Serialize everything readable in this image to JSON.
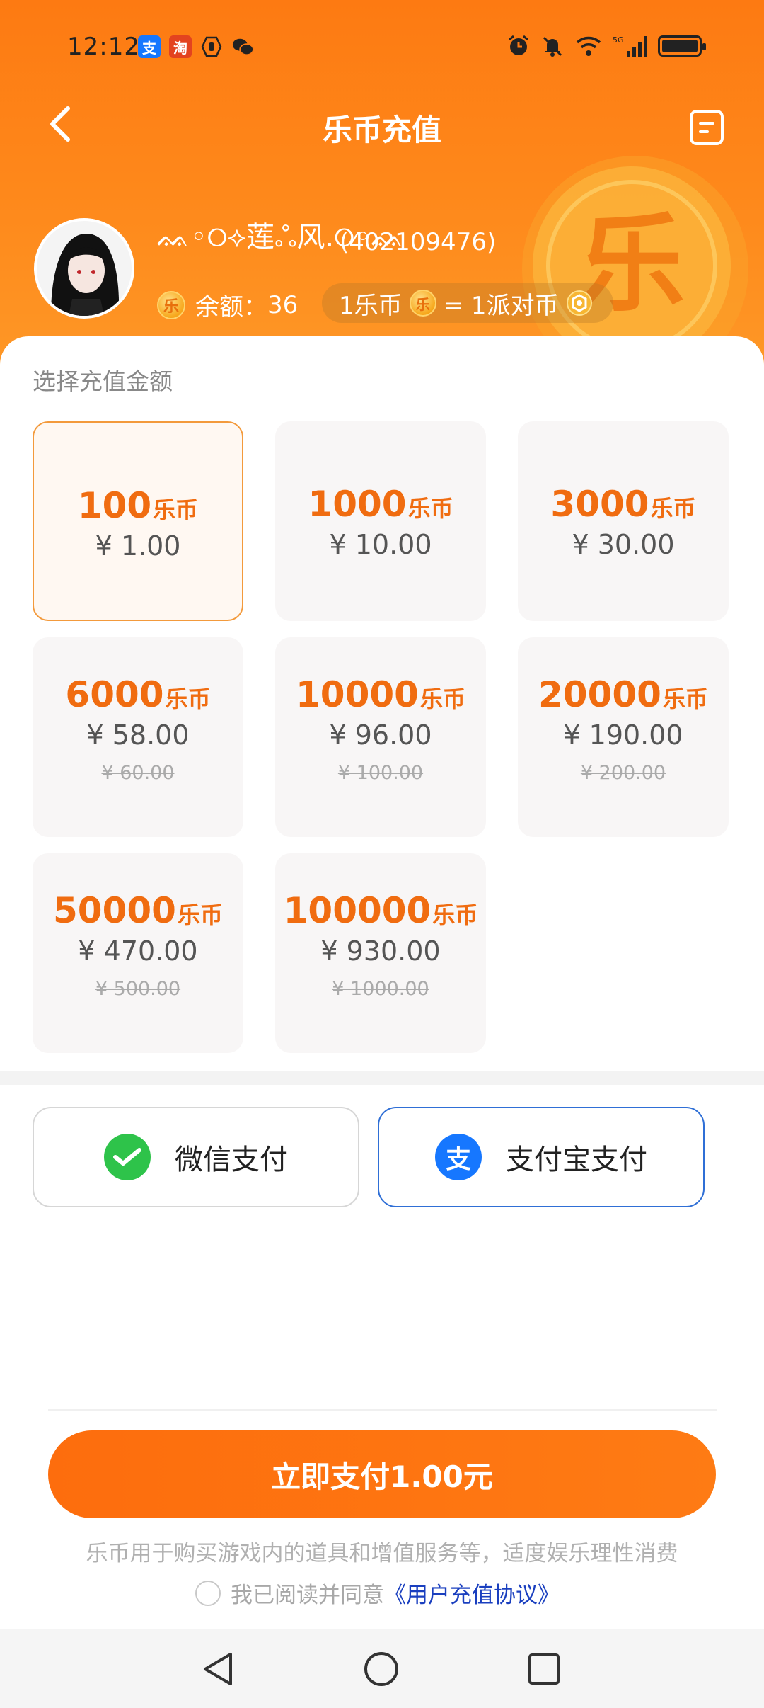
{
  "status_bar": {
    "time": "12:12",
    "left_icons": [
      "alipay-icon",
      "taobao-icon",
      "hand-icon",
      "wechat-icon"
    ],
    "right_icons": [
      "alarm-icon",
      "mute-icon",
      "wifi-icon",
      "5g-signal-icon",
      "battery-icon"
    ]
  },
  "nav": {
    "title": "乐币充值",
    "back_icon": "back-arrow-icon",
    "record_icon": "record-list-icon"
  },
  "user": {
    "name": "ᨐ◦୦⟡莲ஃ风.୦◦ᨐ",
    "id": "(402109476)",
    "coin_glyph": "乐",
    "balance_label": "余额：",
    "balance_value": "36",
    "rate_left": "1乐币",
    "rate_right": "= 1派对币"
  },
  "recharge": {
    "section_label": "选择充值金额",
    "unit": "乐币",
    "tiers": [
      {
        "amount": "100",
        "price": "¥ 1.00",
        "old_price": "",
        "selected": true
      },
      {
        "amount": "1000",
        "price": "¥ 10.00",
        "old_price": "",
        "selected": false
      },
      {
        "amount": "3000",
        "price": "¥ 30.00",
        "old_price": "",
        "selected": false
      },
      {
        "amount": "6000",
        "price": "¥ 58.00",
        "old_price": "¥ 60.00",
        "selected": false
      },
      {
        "amount": "10000",
        "price": "¥ 96.00",
        "old_price": "¥ 100.00",
        "selected": false
      },
      {
        "amount": "20000",
        "price": "¥ 190.00",
        "old_price": "¥ 200.00",
        "selected": false
      },
      {
        "amount": "50000",
        "price": "¥ 470.00",
        "old_price": "¥ 500.00",
        "selected": false
      },
      {
        "amount": "100000",
        "price": "¥ 930.00",
        "old_price": "¥ 1000.00",
        "selected": false
      }
    ]
  },
  "payment": {
    "wechat_label": "微信支付",
    "alipay_label": "支付宝支付",
    "selected": "alipay",
    "colors": {
      "wechat": "#2ec34a",
      "alipay": "#1677ff",
      "active_border": "#2f6fd6"
    }
  },
  "footer": {
    "pay_button": "立即支付1.00元",
    "notice": "乐币用于购买游戏内的道具和增值服务等，适度娱乐理性消费",
    "agree_text": "我已阅读并同意",
    "agreement_link": "《用户充值协议》"
  },
  "system_nav": {
    "back": "back-triangle-icon",
    "home": "home-circle-icon",
    "recents": "recents-square-icon"
  },
  "colors": {
    "brand": "#fd7a12",
    "accent_text": "#f06c10",
    "link": "#1a3fbf"
  }
}
